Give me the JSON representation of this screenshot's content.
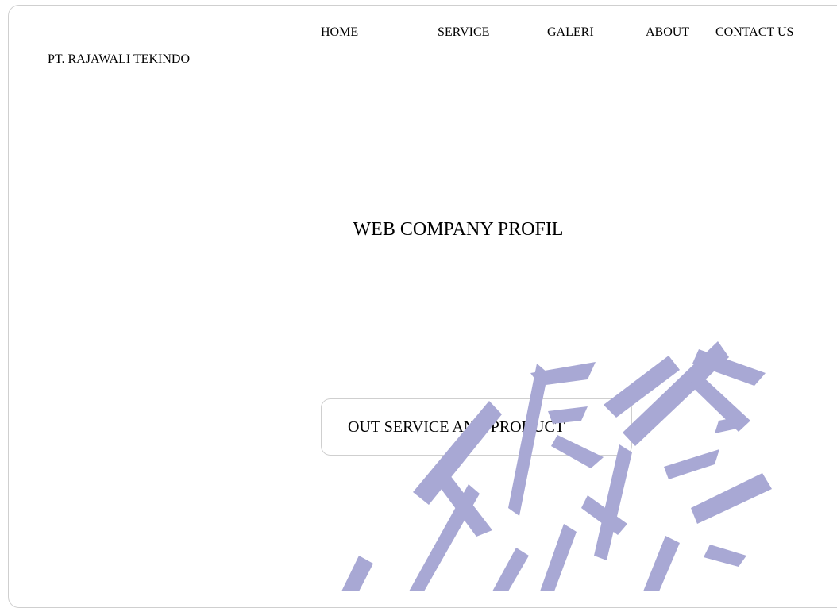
{
  "nav": {
    "items": [
      {
        "label": "HOME"
      },
      {
        "label": "SERVICE"
      },
      {
        "label": "GALERI"
      },
      {
        "label": "ABOUT"
      },
      {
        "label": "CONTACT US"
      }
    ]
  },
  "brand": {
    "name": "PT. RAJAWALI TEKINDO"
  },
  "hero": {
    "title": "WEB COMPANY PROFIL"
  },
  "cta": {
    "label": "OUT SERVICE AND PRODUCT"
  },
  "watermark": {
    "color": "#a8a8d4"
  }
}
